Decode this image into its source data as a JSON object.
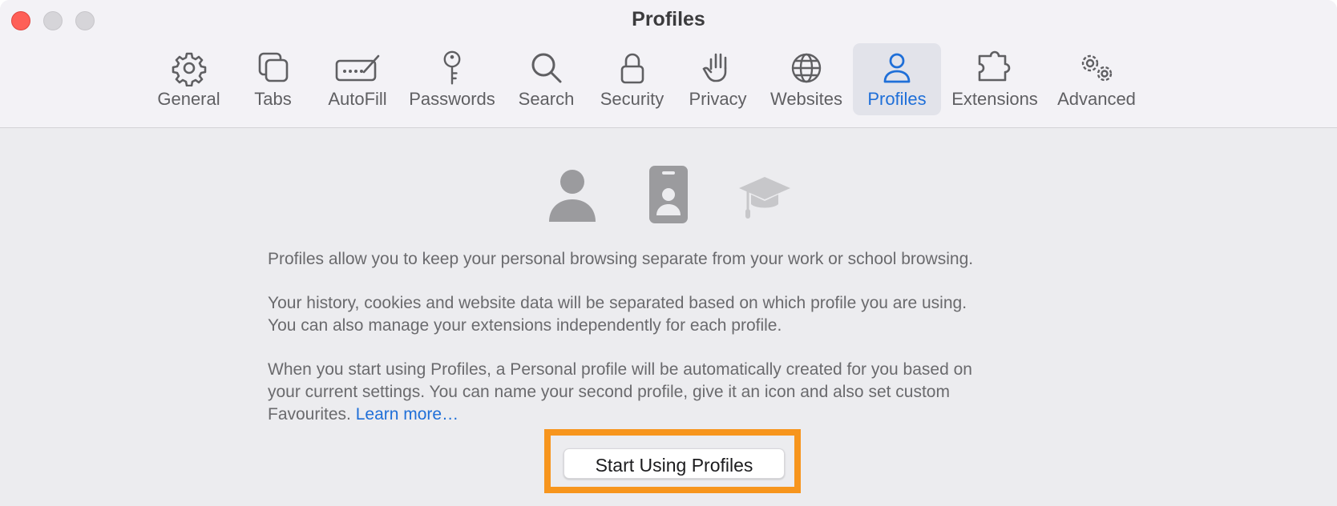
{
  "window": {
    "title": "Profiles"
  },
  "toolbar": {
    "tabs": [
      {
        "label": "General",
        "icon": "gear-icon"
      },
      {
        "label": "Tabs",
        "icon": "tabs-icon"
      },
      {
        "label": "AutoFill",
        "icon": "autofill-icon"
      },
      {
        "label": "Passwords",
        "icon": "key-icon"
      },
      {
        "label": "Search",
        "icon": "search-icon"
      },
      {
        "label": "Security",
        "icon": "lock-icon"
      },
      {
        "label": "Privacy",
        "icon": "hand-icon"
      },
      {
        "label": "Websites",
        "icon": "globe-icon"
      },
      {
        "label": "Profiles",
        "icon": "person-icon"
      },
      {
        "label": "Extensions",
        "icon": "puzzle-icon"
      },
      {
        "label": "Advanced",
        "icon": "gears-icon"
      }
    ],
    "selected": "Profiles"
  },
  "hero_icons": [
    "person-icon",
    "id-badge-icon",
    "graduation-cap-icon"
  ],
  "description": {
    "p1": "Profiles allow you to keep your personal browsing separate from your work or school browsing.",
    "p2_line1": "Your history, cookies and website data will be separated based on which profile you are using.",
    "p2_line2": "You can also manage your extensions independently for each profile.",
    "p3_line1": "When you start using Profiles, a Personal profile will be automatically created for you based on",
    "p3_line2": "your current settings. You can name your second profile, give it an icon and also set custom",
    "p3_line3": "Favourites.",
    "learn_more": "Learn more…"
  },
  "cta": {
    "label": "Start Using Profiles"
  },
  "colors": {
    "accent": "#1f6fd8",
    "highlight": "#f7951d",
    "close": "#fe5f57"
  }
}
